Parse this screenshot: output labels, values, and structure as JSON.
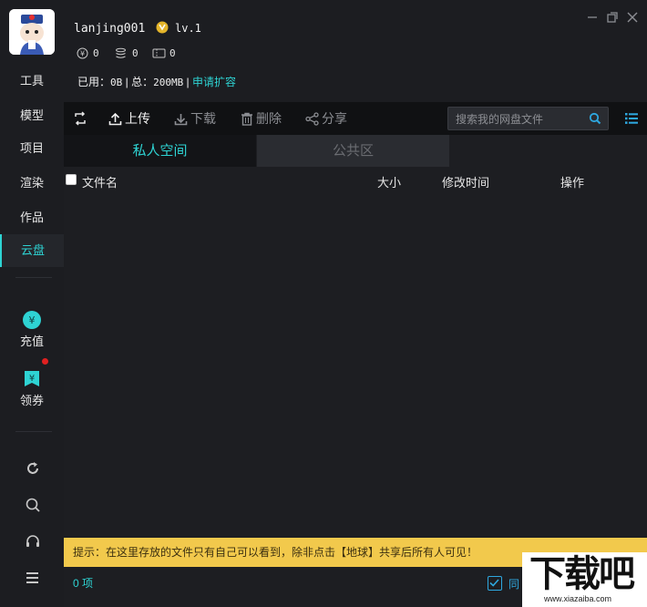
{
  "user": {
    "name": "lanjing001",
    "level": "lv.1"
  },
  "stats": {
    "coins": "0",
    "coins_icon": "yen-circle-icon",
    "credits": "0",
    "credits_icon": "coin-stack-icon",
    "tickets": "0",
    "tickets_icon": "ticket-icon"
  },
  "storage": {
    "used_label": "已用：",
    "used": "0B",
    "total_label": "总：",
    "total": "200MB",
    "expand": "申请扩容"
  },
  "sidebar": {
    "items": [
      {
        "label": "工具"
      },
      {
        "label": "模型"
      },
      {
        "label": "项目"
      },
      {
        "label": "渲染"
      },
      {
        "label": "作品"
      },
      {
        "label": "云盘"
      }
    ],
    "recharge": "充值",
    "coupon": "领券"
  },
  "toolbar": {
    "upload": "上传",
    "download": "下载",
    "delete": "删除",
    "share": "分享"
  },
  "search": {
    "placeholder": "搜索我的网盘文件"
  },
  "tabs": {
    "private": "私人空间",
    "public": "公共区"
  },
  "table": {
    "columns": {
      "name": "文件名",
      "size": "大小",
      "modified": "修改时间",
      "action": "操作"
    }
  },
  "tip": "提示：在这里存放的文件只有自己可以看到，除非点击【地球】共享后所有人可见！",
  "footer": {
    "count": "0 项",
    "sync_label": "同"
  },
  "watermark": {
    "logo": "下载吧",
    "url": "www.xiazaiba.com"
  },
  "colors": {
    "accent": "#2ed3d3",
    "tip_bg": "#f2c94c",
    "badge": "#e02020"
  }
}
